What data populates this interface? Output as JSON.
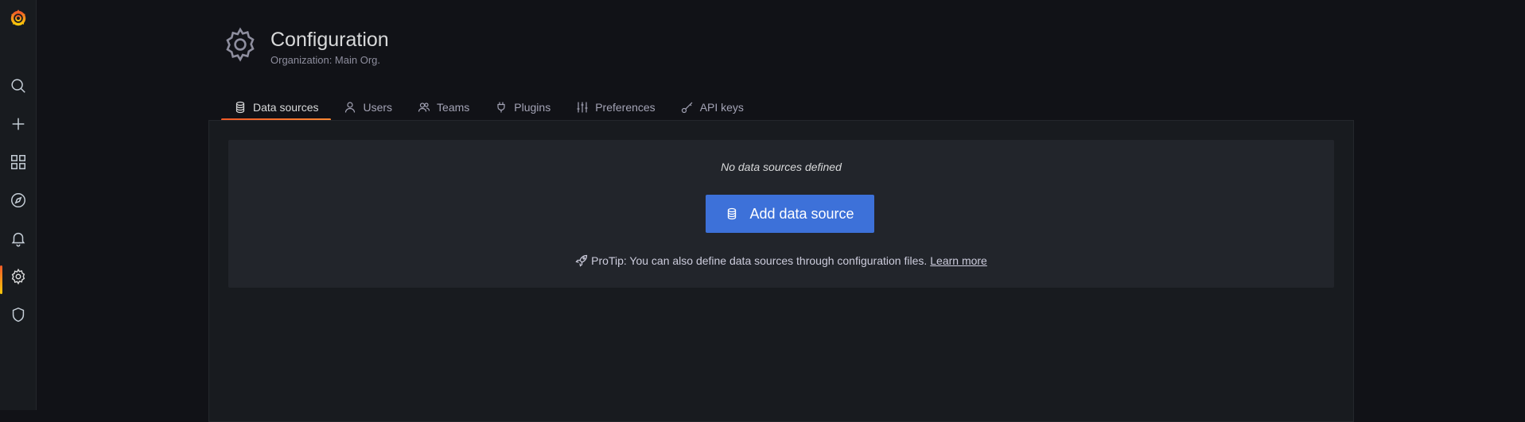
{
  "sidebar": {
    "logo_icon": "grafana-logo-icon",
    "items": [
      {
        "name": "search",
        "icon": "search-icon"
      },
      {
        "name": "create",
        "icon": "plus-icon"
      },
      {
        "name": "dashboards",
        "icon": "apps-grid-icon"
      },
      {
        "name": "explore",
        "icon": "compass-icon"
      },
      {
        "name": "alerting",
        "icon": "bell-icon"
      },
      {
        "name": "configuration",
        "icon": "gear-icon",
        "active": true
      },
      {
        "name": "server-admin",
        "icon": "shield-icon"
      }
    ]
  },
  "header": {
    "title": "Configuration",
    "subtitle": "Organization: Main Org.",
    "icon": "gear-icon"
  },
  "tabs": [
    {
      "label": "Data sources",
      "icon": "database-icon",
      "active": true
    },
    {
      "label": "Users",
      "icon": "user-icon"
    },
    {
      "label": "Teams",
      "icon": "users-icon"
    },
    {
      "label": "Plugins",
      "icon": "plug-icon"
    },
    {
      "label": "Preferences",
      "icon": "sliders-icon"
    },
    {
      "label": "API keys",
      "icon": "key-icon"
    }
  ],
  "empty_state": {
    "title": "No data sources defined",
    "button_label": "Add data source",
    "protip_text": "ProTip: You can also define data sources through configuration files.",
    "learn_more": "Learn more"
  },
  "colors": {
    "accent_orange": "#f05a28",
    "primary_blue": "#3d71d9",
    "background": "#111217",
    "panel": "#181b1f"
  }
}
